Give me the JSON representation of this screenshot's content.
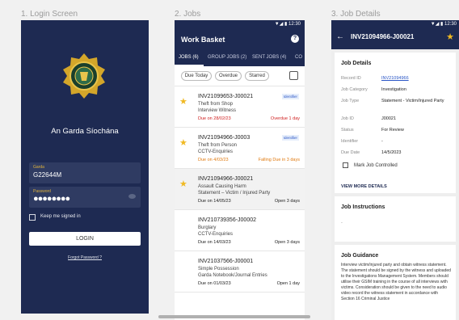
{
  "panels": {
    "login_title": "1. Login Screen",
    "jobs_title": "2. Jobs",
    "details_title": "3. Job Details"
  },
  "login": {
    "org_name": "An Garda Síochána",
    "garda_label": "Garda",
    "garda_value": "G22644M",
    "password_label": "Password",
    "password_mask": "●●●●●●●●",
    "keep_signed_in": "Keep me signed in",
    "login_button": "LOGIN",
    "forgot_password": "Forgot Password ?"
  },
  "jobs": {
    "status_time": "▼◢ ▮ 12:30",
    "app_title": "Work Basket",
    "help": "?",
    "tabs": [
      "JOBS (6)",
      "GROUP JOBS (2)",
      "SENT JOBS (4)",
      "CO"
    ],
    "filters": [
      "Due Today",
      "Overdue",
      "Starred"
    ],
    "rows": [
      {
        "id": "INV21099653-J00021",
        "line2": "Theft from Shop",
        "line3": "Interview Witness",
        "due": "Due on 28/02/23",
        "status": "Overdue 1 day",
        "badge": "Identifier"
      },
      {
        "id": "INV21094966-J0003",
        "line2": "Theft from Person",
        "line3": "CCTV-Enquiries",
        "due": "Due on 4/03/23",
        "status": "Falling Due in 3 days",
        "badge": "Identifier"
      },
      {
        "id": "INV21094966-J00021",
        "line2": "Assault Causing Harm",
        "line3": "Statement – Victim / Injured Party",
        "due": "Due on 14/05/23",
        "status": "Open 3 days",
        "badge": ""
      },
      {
        "id": "INV210739356-J00002",
        "line2": "Burglary",
        "line3": "CCTV-Enquiries",
        "due": "Due on 14/03/23",
        "status": "Open 3 days",
        "badge": ""
      },
      {
        "id": "INV21037566-J00001",
        "line2": "Simple Possession",
        "line3": "Garda Notebook/Journal Entries",
        "due": "Due on 01/03/23",
        "status": "Open 1 day",
        "badge": ""
      }
    ]
  },
  "details": {
    "status_time": "▼◢ ▮ 12:30",
    "title": "INV21094966-J00021",
    "job_details_heading": "Job Details",
    "fields": [
      {
        "label": "Record ID",
        "value": "INV21094966"
      },
      {
        "label": "Job Category",
        "value": "Investigation"
      },
      {
        "label": "Job Type",
        "value": "Statement - Victim/Injured Party"
      },
      {
        "label": "Job ID",
        "value": "J00021"
      },
      {
        "label": "Status",
        "value": "For Review"
      },
      {
        "label": "Identifier",
        "value": "-"
      },
      {
        "label": "Due Date",
        "value": "14/5/2023"
      }
    ],
    "mark_controlled": "Mark Job Controlled",
    "view_more": "VIEW MORE DETAILS",
    "instructions_heading": "Job Instructions",
    "instructions_value": "-",
    "guidance_heading": "Job Guidance",
    "guidance_text": "Interview victim/injured party and obtain witness statement. The statement should be signed by the witness and uploaded to the Investigations Management System. Members should utilise their GSIM training in the course of all interviews with victims. Consideration should be given to the need to audio video record the witness statement in accordance with Section 16 Criminal Justice"
  }
}
